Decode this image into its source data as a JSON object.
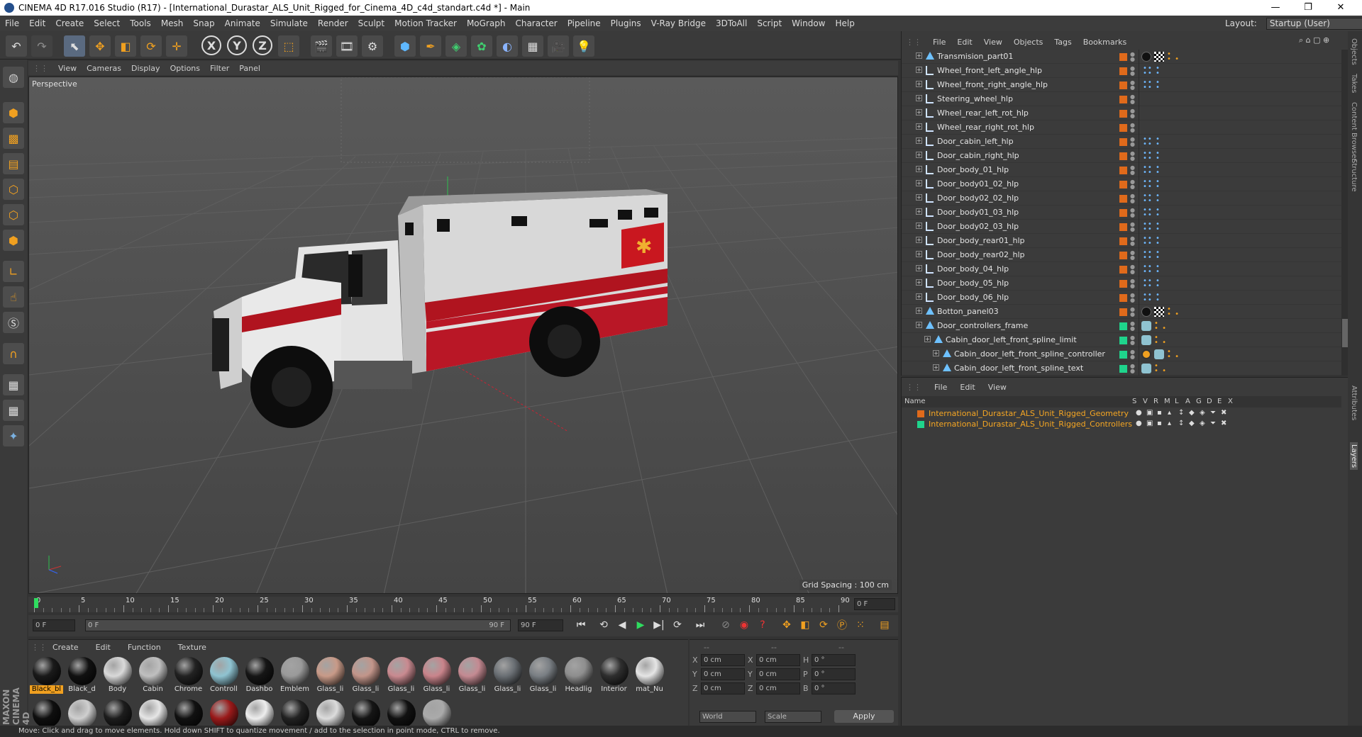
{
  "window": {
    "title": "CINEMA 4D R17.016 Studio (R17) - [International_Durastar_ALS_Unit_Rigged_for_Cinema_4D_c4d_standart.c4d *] - Main",
    "minimize": "—",
    "maximize": "❐",
    "close": "✕"
  },
  "menu": {
    "items": [
      "File",
      "Edit",
      "Create",
      "Select",
      "Tools",
      "Mesh",
      "Snap",
      "Animate",
      "Simulate",
      "Render",
      "Sculpt",
      "Motion Tracker",
      "MoGraph",
      "Character",
      "Pipeline",
      "Plugins",
      "V-Ray Bridge",
      "3DToAll",
      "Script",
      "Window",
      "Help"
    ],
    "layout_label": "Layout:",
    "layout_value": "Startup (User)"
  },
  "toolbar": {
    "axis_x": "X",
    "axis_y": "Y",
    "axis_z": "Z"
  },
  "viewport": {
    "menu": [
      "View",
      "Cameras",
      "Display",
      "Options",
      "Filter",
      "Panel"
    ],
    "camera_label": "Perspective",
    "grid_spacing": "Grid Spacing : 100 cm"
  },
  "timeline": {
    "ticks": [
      "0",
      "5",
      "10",
      "15",
      "20",
      "25",
      "30",
      "35",
      "40",
      "45",
      "50",
      "55",
      "60",
      "65",
      "70",
      "75",
      "80",
      "85",
      "90"
    ],
    "current_frame": "0 F"
  },
  "transport": {
    "start_frame": "0 F",
    "range_start": "0 F",
    "range_end": "90 F",
    "end_frame": "90 F"
  },
  "materials": {
    "menu": [
      "Create",
      "Edit",
      "Function",
      "Texture"
    ],
    "brand": "MAXON CINEMA 4D",
    "row1": [
      {
        "label": "Black_bl",
        "color": "#1a1a1a"
      },
      {
        "label": "Black_d",
        "color": "#111"
      },
      {
        "label": "Body",
        "color": "#d9d9d9"
      },
      {
        "label": "Cabin",
        "color": "#bfbfbf"
      },
      {
        "label": "Chrome",
        "color": "#222"
      },
      {
        "label": "Controll",
        "color": "#8fc3d1"
      },
      {
        "label": "Dashbo",
        "color": "#161616"
      },
      {
        "label": "Emblem",
        "color": "#9a9a9a"
      },
      {
        "label": "Glass_li",
        "color": "#c89a88"
      },
      {
        "label": "Glass_li",
        "color": "#c2958a"
      },
      {
        "label": "Glass_li",
        "color": "#c98a90"
      },
      {
        "label": "Glass_li",
        "color": "#c9848b"
      },
      {
        "label": "Glass_li",
        "color": "#c48a92"
      },
      {
        "label": "Glass_li",
        "color": "#6a6f74"
      },
      {
        "label": "Glass_li",
        "color": "#7a7f84"
      },
      {
        "label": "Headlig",
        "color": "#8e8e8e"
      },
      {
        "label": "Interior",
        "color": "#2e2e2e"
      },
      {
        "label": "mat_Nu",
        "color": "#e5e5e5"
      }
    ],
    "row2_colors": [
      "#0f0f0f",
      "#cfcfcf",
      "#1d1d1d",
      "#e6e6e6",
      "#111",
      "#9a1a1a",
      "#eee",
      "#222",
      "#dcdcdc",
      "#151515",
      "#111",
      "#aaa"
    ]
  },
  "coords": {
    "headers": [
      "--",
      "--",
      "--"
    ],
    "rows": [
      {
        "a": "X",
        "av": "0 cm",
        "b": "X",
        "bv": "0 cm",
        "c": "H",
        "cv": "0 °"
      },
      {
        "a": "Y",
        "av": "0 cm",
        "b": "Y",
        "bv": "0 cm",
        "c": "P",
        "cv": "0 °"
      },
      {
        "a": "Z",
        "av": "0 cm",
        "b": "Z",
        "bv": "0 cm",
        "c": "B",
        "cv": "0 °"
      }
    ],
    "mode": "World",
    "scale": "Scale",
    "apply": "Apply"
  },
  "objects": {
    "menu": [
      "File",
      "Edit",
      "View",
      "Objects",
      "Tags",
      "Bookmarks"
    ],
    "rows": [
      {
        "name": "Transmision_part01",
        "indent": 1,
        "kind": "tri",
        "swatch": "#e06a1b",
        "tags": "mat"
      },
      {
        "name": "Wheel_front_left_angle_hlp",
        "indent": 1,
        "kind": "null",
        "swatch": "#e06a1b",
        "tags": "dots"
      },
      {
        "name": "Wheel_front_right_angle_hlp",
        "indent": 1,
        "kind": "null",
        "swatch": "#e06a1b",
        "tags": "dots"
      },
      {
        "name": "Steering_wheel_hlp",
        "indent": 1,
        "kind": "null",
        "swatch": "#e06a1b",
        "tags": ""
      },
      {
        "name": "Wheel_rear_left_rot_hlp",
        "indent": 1,
        "kind": "null",
        "swatch": "#e06a1b",
        "tags": ""
      },
      {
        "name": "Wheel_rear_right_rot_hlp",
        "indent": 1,
        "kind": "null",
        "swatch": "#e06a1b",
        "tags": ""
      },
      {
        "name": "Door_cabin_left_hlp",
        "indent": 1,
        "kind": "null",
        "swatch": "#e06a1b",
        "tags": "dots"
      },
      {
        "name": "Door_cabin_right_hlp",
        "indent": 1,
        "kind": "null",
        "swatch": "#e06a1b",
        "tags": "dots"
      },
      {
        "name": "Door_body_01_hlp",
        "indent": 1,
        "kind": "null",
        "swatch": "#e06a1b",
        "tags": "dots"
      },
      {
        "name": "Door_body01_02_hlp",
        "indent": 1,
        "kind": "null",
        "swatch": "#e06a1b",
        "tags": "dots"
      },
      {
        "name": "Door_body02_02_hlp",
        "indent": 1,
        "kind": "null",
        "swatch": "#e06a1b",
        "tags": "dots"
      },
      {
        "name": "Door_body01_03_hlp",
        "indent": 1,
        "kind": "null",
        "swatch": "#e06a1b",
        "tags": "dots"
      },
      {
        "name": "Door_body02_03_hlp",
        "indent": 1,
        "kind": "null",
        "swatch": "#e06a1b",
        "tags": "dots"
      },
      {
        "name": "Door_body_rear01_hlp",
        "indent": 1,
        "kind": "null",
        "swatch": "#e06a1b",
        "tags": "dots"
      },
      {
        "name": "Door_body_rear02_hlp",
        "indent": 1,
        "kind": "null",
        "swatch": "#e06a1b",
        "tags": "dots"
      },
      {
        "name": "Door_body_04_hlp",
        "indent": 1,
        "kind": "null",
        "swatch": "#e06a1b",
        "tags": "dots"
      },
      {
        "name": "Door_body_05_hlp",
        "indent": 1,
        "kind": "null",
        "swatch": "#e06a1b",
        "tags": "dots"
      },
      {
        "name": "Door_body_06_hlp",
        "indent": 1,
        "kind": "null",
        "swatch": "#e06a1b",
        "tags": "dots"
      },
      {
        "name": "Botton_panel03",
        "indent": 1,
        "kind": "tri",
        "swatch": "#e06a1b",
        "tags": "mat"
      },
      {
        "name": "Door_controllers_frame",
        "indent": 1,
        "kind": "tri",
        "swatch": "#1fd48c",
        "tags": "ctrl"
      },
      {
        "name": "Cabin_door_left_front_spline_limit",
        "indent": 2,
        "kind": "tri",
        "swatch": "#1fd48c",
        "tags": "ctrl"
      },
      {
        "name": "Cabin_door_left_front_spline_controller",
        "indent": 3,
        "kind": "tri",
        "swatch": "#1fd48c",
        "tags": "ctrl2"
      },
      {
        "name": "Cabin_door_left_front_spline_text",
        "indent": 3,
        "kind": "tri",
        "swatch": "#1fd48c",
        "tags": "ctrl"
      }
    ]
  },
  "layers": {
    "menu": [
      "File",
      "Edit",
      "View"
    ],
    "headers": [
      "Name",
      "S",
      "V",
      "R",
      "M",
      "L",
      "A",
      "G",
      "D",
      "E",
      "X"
    ],
    "rows": [
      {
        "name": "International_Durastar_ALS_Unit_Rigged_Geometry",
        "color": "#e06a1b"
      },
      {
        "name": "International_Durastar_ALS_Unit_Rigged_Controllers",
        "color": "#1fd48c"
      }
    ]
  },
  "side_tabs": [
    "Objects",
    "Takes",
    "Content Browser",
    "Structure",
    "Attributes",
    "Layers"
  ],
  "status": "Move: Click and drag to move elements. Hold down SHIFT to quantize movement / add to the selection in point mode, CTRL to remove."
}
